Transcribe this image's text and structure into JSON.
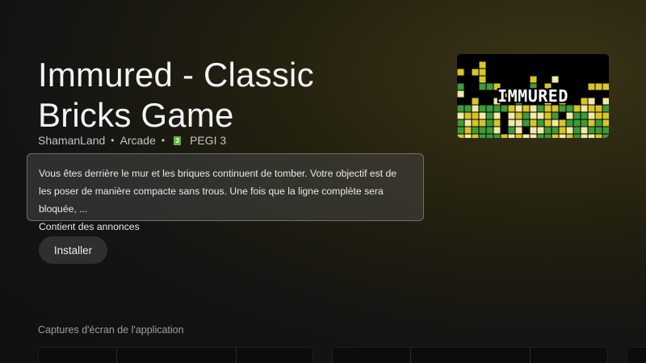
{
  "app": {
    "title": "Immured - Classic Bricks Game",
    "developer": "ShamanLand",
    "category": "Arcade",
    "rating": "PEGI 3",
    "rating_badge": "3"
  },
  "description": {
    "text": "Vous êtes derrière le mur et les briques continuent de tomber. Votre objectif est de les poser de manière compacte sans trous. Une fois que la ligne complète sera bloquée, ...",
    "ads_notice": "Contient des annonces"
  },
  "actions": {
    "install_label": "Installer"
  },
  "screenshots": {
    "section_title": "Captures d'écran de l'application"
  },
  "cover": {
    "logo_text": "IMMURED",
    "colors": {
      "green": "#3f9a3a",
      "yellow": "#d8c52a",
      "cream": "#f1e9a6"
    }
  },
  "theme": {
    "pegi_green": "#5cb83b"
  }
}
